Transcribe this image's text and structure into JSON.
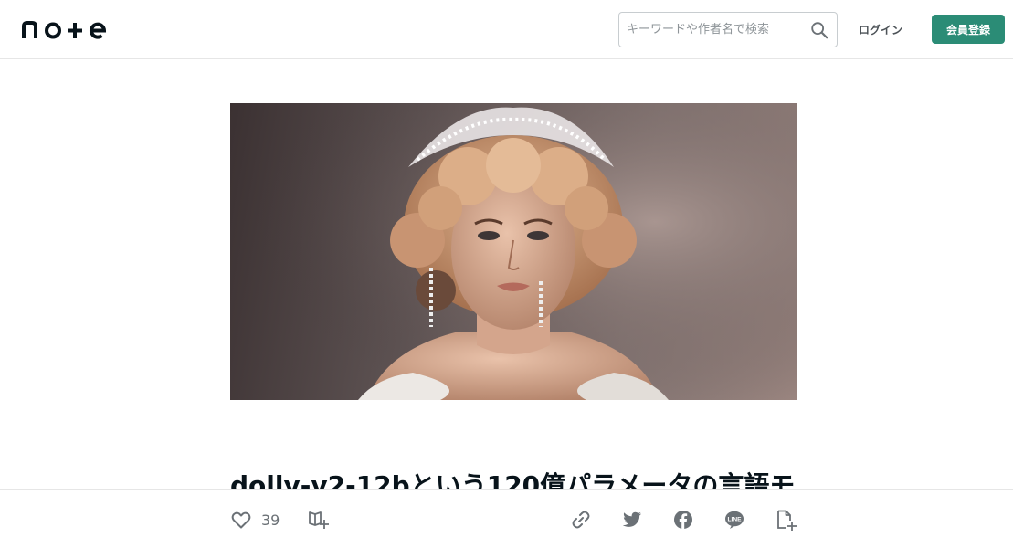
{
  "header": {
    "logo_text": "note",
    "search": {
      "placeholder": "キーワードや作者名で検索",
      "value": ""
    },
    "login_label": "ログイン",
    "signup_label": "会員登録",
    "accent_color": "#2b8c76"
  },
  "article": {
    "hero_image": "portrait of a woman with ornate blonde updo and sparkling tiara on brown background",
    "title": "dolly-v2-12bという120億パラメータの言語モ"
  },
  "actions": {
    "like_count": "39",
    "icons": [
      "heart-icon",
      "magazine-add-icon",
      "link-icon",
      "twitter-icon",
      "facebook-icon",
      "line-icon",
      "embed-icon"
    ]
  }
}
